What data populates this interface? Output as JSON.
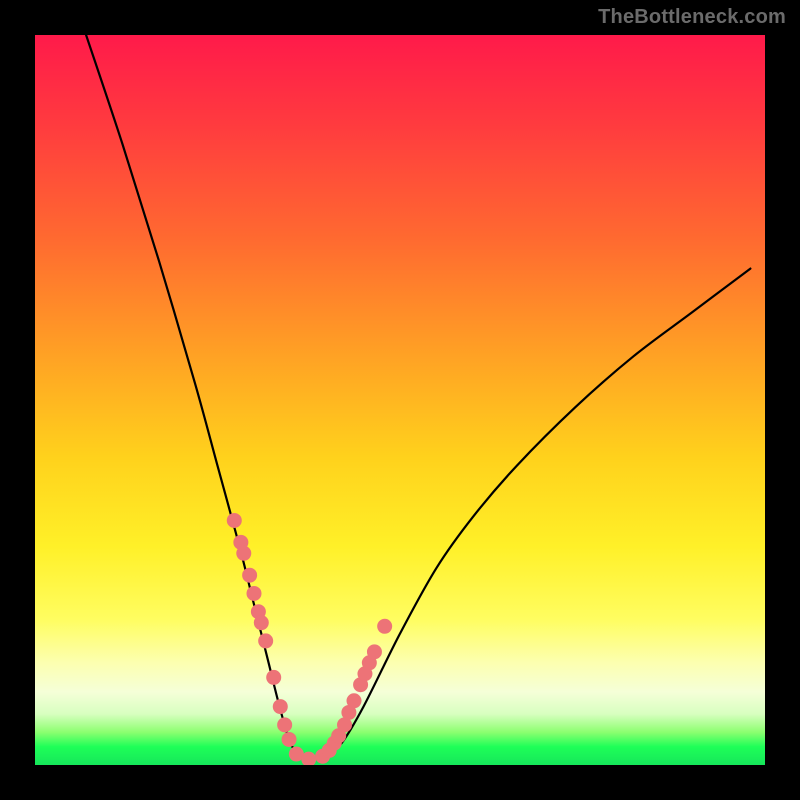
{
  "watermark": "TheBottleneck.com",
  "chart_data": {
    "type": "line",
    "title": "",
    "xlabel": "",
    "ylabel": "",
    "xlim": [
      0,
      100
    ],
    "ylim": [
      0,
      100
    ],
    "grid": false,
    "series": [
      {
        "name": "bottleneck-curve",
        "x": [
          7,
          12,
          17,
          22,
          25,
          28,
          30,
          32,
          33.5,
          35,
          36.5,
          38,
          40,
          42,
          45,
          50,
          55,
          60,
          66,
          74,
          82,
          90,
          98
        ],
        "values": [
          100,
          85,
          69,
          52,
          41,
          30,
          22,
          14,
          8,
          3,
          1,
          1,
          1.5,
          3,
          8,
          18,
          27,
          34,
          41,
          49,
          56,
          62,
          68
        ]
      }
    ],
    "markers": {
      "name": "highlight-dots",
      "color": "#ed7377",
      "x": [
        27.3,
        28.2,
        28.6,
        29.4,
        30.0,
        30.6,
        31.0,
        31.6,
        32.7,
        33.6,
        34.2,
        34.8,
        35.8,
        37.5,
        39.4,
        40.3,
        41.0,
        41.6,
        42.4,
        43.0,
        43.7,
        44.6,
        45.2,
        45.8,
        46.5,
        47.9
      ],
      "values": [
        33.5,
        30.5,
        29.0,
        26.0,
        23.5,
        21.0,
        19.5,
        17.0,
        12.0,
        8.0,
        5.5,
        3.5,
        1.5,
        0.8,
        1.2,
        2.0,
        3.0,
        4.0,
        5.5,
        7.2,
        8.8,
        11.0,
        12.5,
        14.0,
        15.5,
        19.0
      ]
    },
    "background": {
      "type": "vertical-gradient",
      "stops": [
        {
          "pos": 0.0,
          "color": "#ff1a4a"
        },
        {
          "pos": 0.28,
          "color": "#ff6a30"
        },
        {
          "pos": 0.58,
          "color": "#ffd21c"
        },
        {
          "pos": 0.8,
          "color": "#fffd60"
        },
        {
          "pos": 0.93,
          "color": "#d8ffc0"
        },
        {
          "pos": 0.975,
          "color": "#1eff58"
        },
        {
          "pos": 1.0,
          "color": "#16e65a"
        }
      ]
    }
  }
}
